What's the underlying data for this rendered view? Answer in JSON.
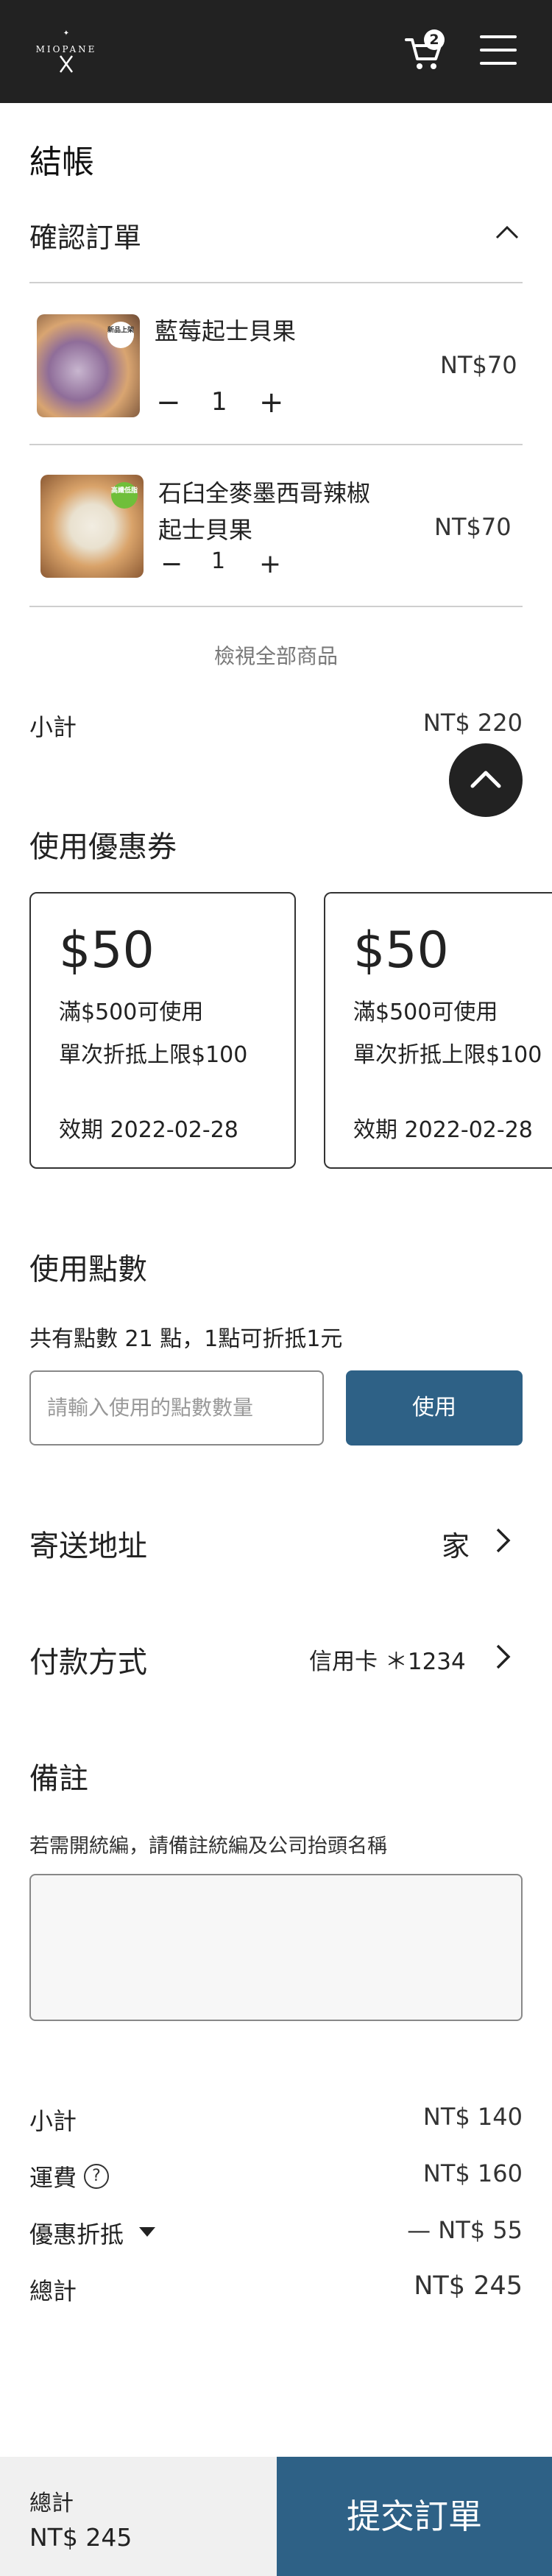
{
  "header": {
    "logo_text": "MIOPANE",
    "cart_count": "2"
  },
  "page_title": "結帳",
  "order": {
    "title": "確認訂單",
    "items": [
      {
        "name_lines": [
          "藍莓起士貝果"
        ],
        "price": "NT$70",
        "qty": "1",
        "badge": "新品上架"
      },
      {
        "name_lines": [
          "石臼全麥墨西哥辣椒",
          "起士貝果"
        ],
        "price": "NT$70",
        "qty": "1",
        "badge": "高纖低脂"
      }
    ],
    "view_all": "檢視全部商品",
    "subtotal_label": "小計",
    "subtotal_value": "NT$ 220"
  },
  "coupons": {
    "title": "使用優惠券",
    "items": [
      {
        "amount": "$50",
        "condition": "滿$500可使用",
        "limit": "單次折抵上限$100",
        "expiry": "效期 2022-02-28"
      },
      {
        "amount": "$50",
        "condition": "滿$500可使用",
        "limit": "單次折抵上限$100",
        "expiry": "效期 2022-02-28"
      }
    ]
  },
  "points": {
    "title": "使用點數",
    "info": "共有點數 21 點，1點可折抵1元",
    "placeholder": "請輸入使用的點數數量",
    "button": "使用"
  },
  "shipping": {
    "label": "寄送地址",
    "value": "家"
  },
  "payment": {
    "label": "付款方式",
    "value": "信用卡 ＊1234"
  },
  "notes": {
    "title": "備註",
    "hint": "若需開統編，請備註統編及公司抬頭名稱"
  },
  "summary": {
    "subtotal_label": "小計",
    "subtotal_value": "NT$ 140",
    "shipping_label": "運費",
    "shipping_value": "NT$ 160",
    "discount_label": "優惠折抵",
    "discount_value": "— NT$ 55",
    "total_label": "總計",
    "total_value": "NT$ 245"
  },
  "footer": {
    "total_label": "總計",
    "total_value": "NT$ 245",
    "submit": "提交訂單"
  },
  "colors": {
    "topbar": "#222222",
    "accent": "#2e6186"
  }
}
